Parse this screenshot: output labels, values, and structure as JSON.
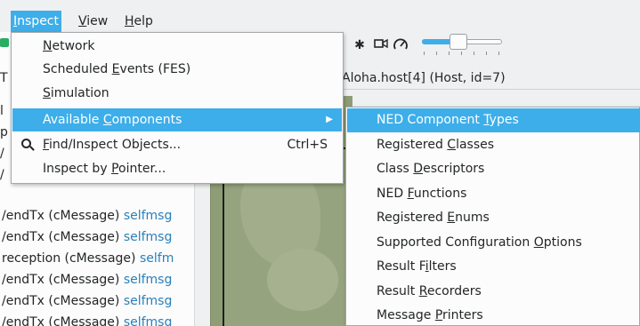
{
  "menubar": {
    "items": [
      {
        "label": "Inspect",
        "underline_first": true,
        "active": true
      },
      {
        "label": "View",
        "underline_first": true,
        "active": false
      },
      {
        "label": "Help",
        "underline_first": true,
        "active": false
      }
    ]
  },
  "inspect_menu": {
    "items": [
      {
        "pre": "",
        "ul": "N",
        "post": "etwork",
        "shortcut": "",
        "has_submenu": false,
        "highlighted": false,
        "icon": ""
      },
      {
        "pre": "Scheduled ",
        "ul": "E",
        "post": "vents (FES)",
        "shortcut": "",
        "has_submenu": false,
        "highlighted": false,
        "icon": ""
      },
      {
        "pre": "",
        "ul": "S",
        "post": "imulation",
        "shortcut": "",
        "has_submenu": false,
        "highlighted": false,
        "icon": ""
      },
      {
        "pre": "Available ",
        "ul": "C",
        "post": "omponents",
        "shortcut": "",
        "has_submenu": true,
        "highlighted": true,
        "icon": ""
      },
      {
        "pre": "",
        "ul": "F",
        "post": "ind/Inspect Objects...",
        "shortcut": "Ctrl+S",
        "has_submenu": false,
        "highlighted": false,
        "icon": "magnifier-icon"
      },
      {
        "pre": "Inspect by ",
        "ul": "P",
        "post": "ointer...",
        "shortcut": "",
        "has_submenu": false,
        "highlighted": false,
        "icon": ""
      }
    ]
  },
  "components_submenu": {
    "items": [
      {
        "pre": "NED Component ",
        "ul": "T",
        "post": "ypes",
        "highlighted": true
      },
      {
        "pre": "Registered ",
        "ul": "C",
        "post": "lasses",
        "highlighted": false
      },
      {
        "pre": "Class ",
        "ul": "D",
        "post": "escriptors",
        "highlighted": false
      },
      {
        "pre": "NED ",
        "ul": "F",
        "post": "unctions",
        "highlighted": false
      },
      {
        "pre": "Registered ",
        "ul": "E",
        "post": "nums",
        "highlighted": false
      },
      {
        "pre": "Supported Configuration ",
        "ul": "O",
        "post": "ptions",
        "highlighted": false
      },
      {
        "pre": "Result F",
        "ul": "i",
        "post": "lters",
        "highlighted": false
      },
      {
        "pre": "Result ",
        "ul": "R",
        "post": "ecorders",
        "highlighted": false
      },
      {
        "pre": "Message ",
        "ul": "P",
        "post": "rinters",
        "highlighted": false
      }
    ]
  },
  "inspector": {
    "title": "Aloha.host[4] (Host, id=7)"
  },
  "toolbar": {
    "icons": [
      "pin-icon",
      "video-camera-icon",
      "speedometer-icon"
    ],
    "speed_slider_fraction": 0.45
  },
  "log_panel": {
    "rows": [
      {
        "prefix": "/endTx (cMessage) ",
        "link": "selfmsg"
      },
      {
        "prefix": "/endTx (cMessage) ",
        "link": "selfmsg"
      },
      {
        "prefix": "reception (cMessage) ",
        "link": "selfm"
      },
      {
        "prefix": "/endTx (cMessage) ",
        "link": "selfmsg"
      },
      {
        "prefix": "/endTx (cMessage) ",
        "link": "selfmsg"
      },
      {
        "prefix": "/endTx (cMessage) ",
        "link": "selfmsg"
      }
    ],
    "stubs": [
      "T",
      "l",
      "p",
      "/",
      "/"
    ]
  },
  "colors": {
    "highlight": "#3daee9",
    "link": "#2980b9",
    "canvas": "#8f9d76"
  }
}
